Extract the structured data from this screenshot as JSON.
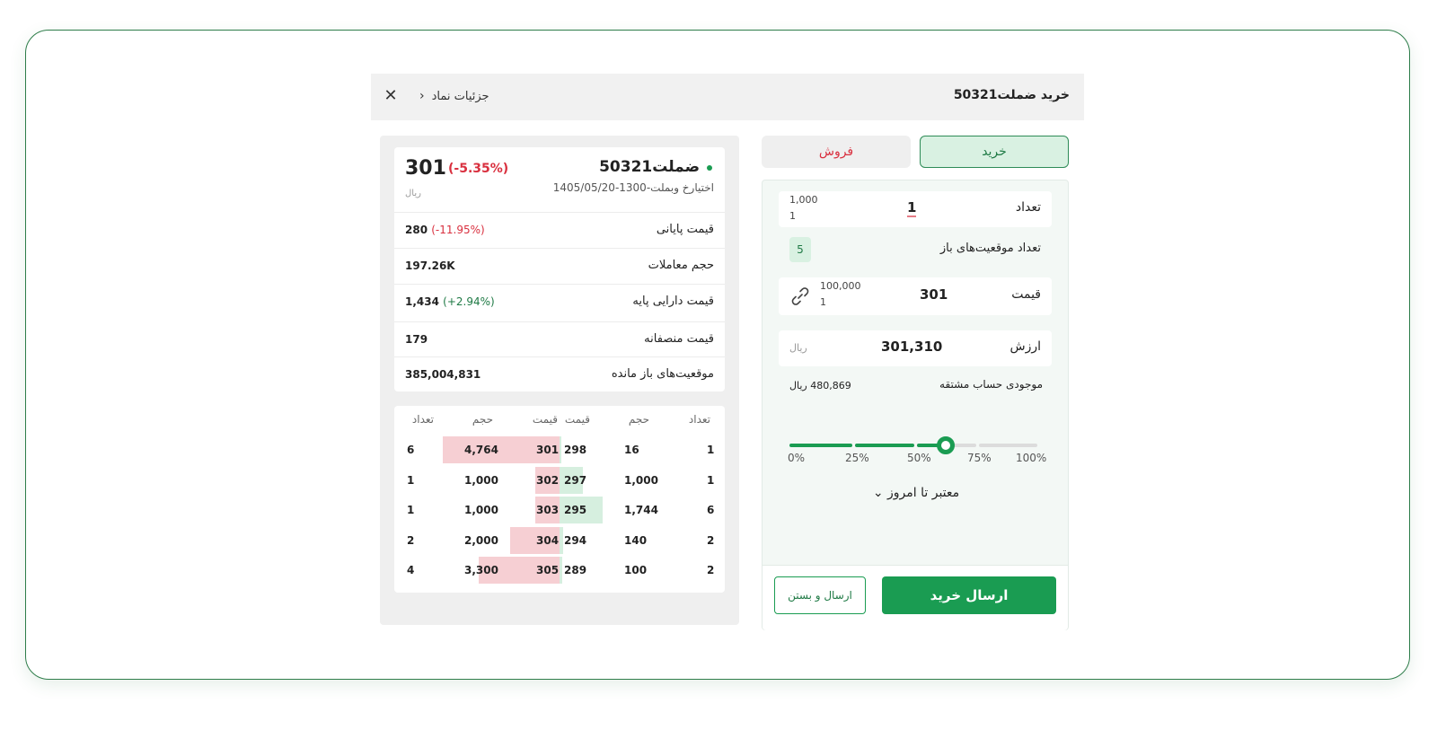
{
  "header": {
    "title": "خرید ضملت50321",
    "details_link": "جزئیات نماد",
    "close_glyph": "✕"
  },
  "order": {
    "tabs": {
      "buy": "خرید",
      "sell": "فروش"
    },
    "quantity": {
      "label": "تعداد",
      "value": "1",
      "max": "1,000",
      "min": "1"
    },
    "open_positions": {
      "label": "تعداد موقعیت‌های باز",
      "value": "5"
    },
    "price": {
      "label": "قیمت",
      "value": "301",
      "max": "100,000",
      "min": "1"
    },
    "value": {
      "label": "ارزش",
      "amount": "301,310",
      "unit": "ریال"
    },
    "balance": {
      "label": "موجودی حساب مشتقه",
      "amount": "480,869",
      "unit": "ریال"
    },
    "slider": {
      "fraction": 0.63,
      "ticks": [
        "0%",
        "25%",
        "50%",
        "75%",
        "100%"
      ]
    },
    "validity": "معتبر تا امروز",
    "submit_button": "ارسال خرید",
    "submit_close_button": "ارسال و بستن"
  },
  "symbol": {
    "name": "ضملت50321",
    "description": "اختیارخ وبملت-1300-1405/05/20",
    "price": "301",
    "change": "(-5.35%)",
    "unit": "ریال",
    "rows": [
      {
        "label": "قیمت پایانی",
        "value": "280",
        "pct": "(-11.95%)",
        "pct_color": "red"
      },
      {
        "label": "حجم معاملات",
        "value": "197.26K",
        "pct": "",
        "pct_color": ""
      },
      {
        "label": "قیمت دارایی پایه",
        "value": "1,434",
        "pct": "(+2.94%)",
        "pct_color": "green"
      },
      {
        "label": "قیمت منصفانه",
        "value": "179",
        "pct": "",
        "pct_color": ""
      },
      {
        "label": "موقعیت‌های باز مانده",
        "value": "385,004,831",
        "pct": "",
        "pct_color": ""
      }
    ]
  },
  "order_book": {
    "headers": {
      "buy_count": "تعداد",
      "buy_volume": "حجم",
      "buy_price": "قیمت",
      "sell_price": "قیمت",
      "sell_volume": "حجم",
      "sell_count": "تعداد"
    },
    "rows": [
      {
        "buy_count": "1",
        "buy_volume": "16",
        "buy_price": "298",
        "sell_price": "301",
        "sell_volume": "4,764",
        "sell_count": "6",
        "buy_depth": 0.01,
        "sell_depth": 1.0
      },
      {
        "buy_count": "1",
        "buy_volume": "1,000",
        "buy_price": "297",
        "sell_price": "302",
        "sell_volume": "1,000",
        "sell_count": "1",
        "buy_depth": 0.55,
        "sell_depth": 0.21
      },
      {
        "buy_count": "6",
        "buy_volume": "1,744",
        "buy_price": "295",
        "sell_price": "303",
        "sell_volume": "1,000",
        "sell_count": "1",
        "buy_depth": 1.0,
        "sell_depth": 0.21
      },
      {
        "buy_count": "2",
        "buy_volume": "140",
        "buy_price": "294",
        "sell_price": "304",
        "sell_volume": "2,000",
        "sell_count": "2",
        "buy_depth": 0.08,
        "sell_depth": 0.42
      },
      {
        "buy_count": "2",
        "buy_volume": "100",
        "buy_price": "289",
        "sell_price": "305",
        "sell_volume": "3,300",
        "sell_count": "4",
        "buy_depth": 0.06,
        "sell_depth": 0.69
      }
    ]
  },
  "colors": {
    "accent": "#1a9c52",
    "sell": "#d9303f",
    "buy_text": "#1f7a45"
  }
}
